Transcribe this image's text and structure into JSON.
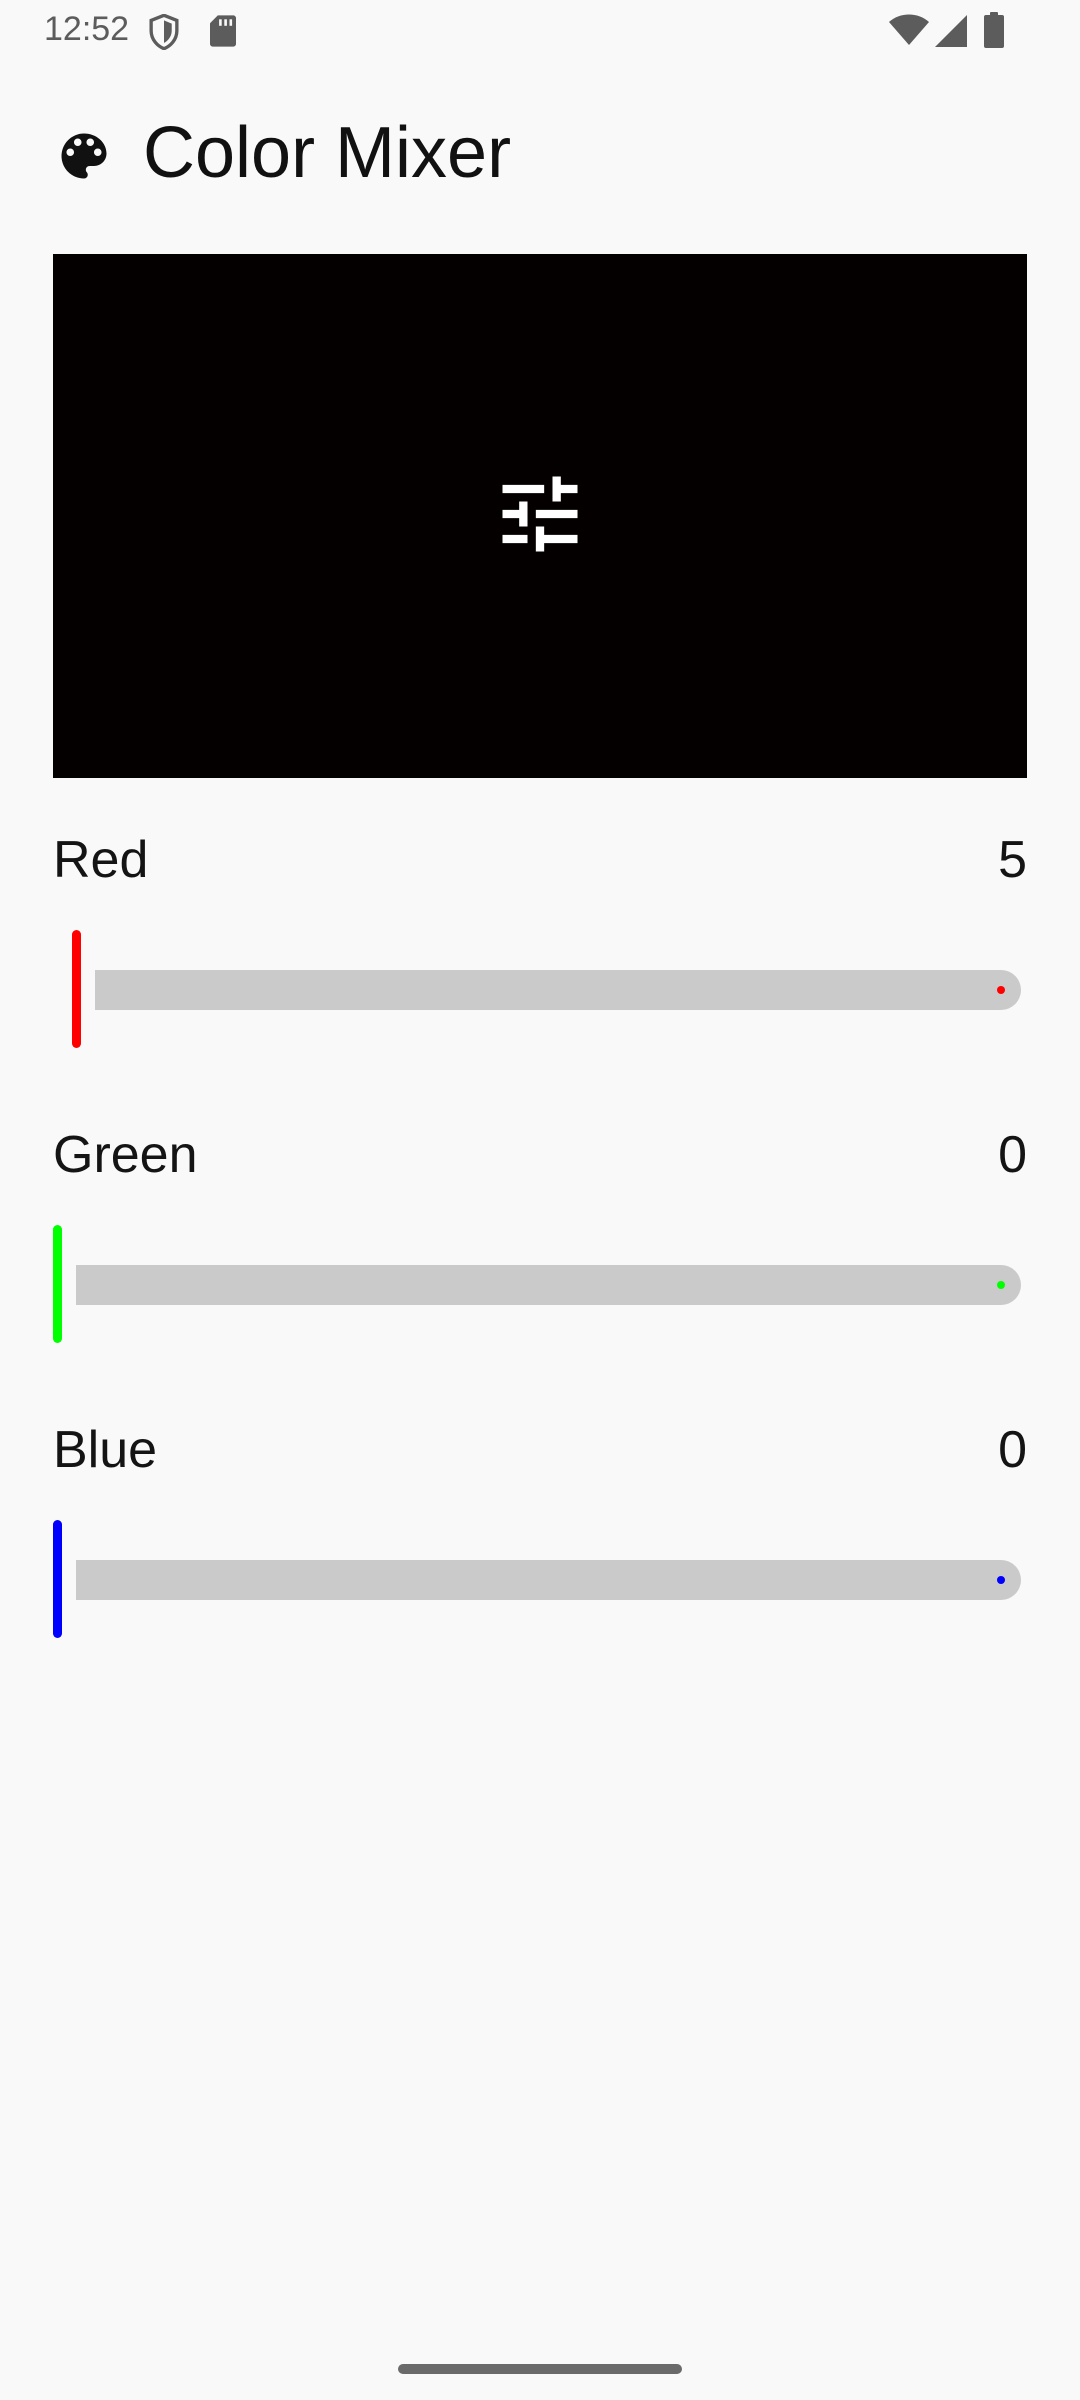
{
  "status_bar": {
    "time": "12:52",
    "left_icons": [
      "shield-icon",
      "sd-card-icon"
    ],
    "right_icons": [
      "wifi-icon",
      "cell-signal-icon",
      "battery-icon"
    ]
  },
  "header": {
    "icon": "palette-icon",
    "title": "Color Mixer"
  },
  "preview": {
    "color": "#050000",
    "icon": "tune-icon",
    "icon_color": "#ffffff"
  },
  "channels": [
    {
      "label": "Red",
      "value": "5",
      "max": 255,
      "color": "#ff0000"
    },
    {
      "label": "Green",
      "value": "0",
      "max": 255,
      "color": "#00ff00"
    },
    {
      "label": "Blue",
      "value": "0",
      "max": 255,
      "color": "#0000ff"
    }
  ]
}
